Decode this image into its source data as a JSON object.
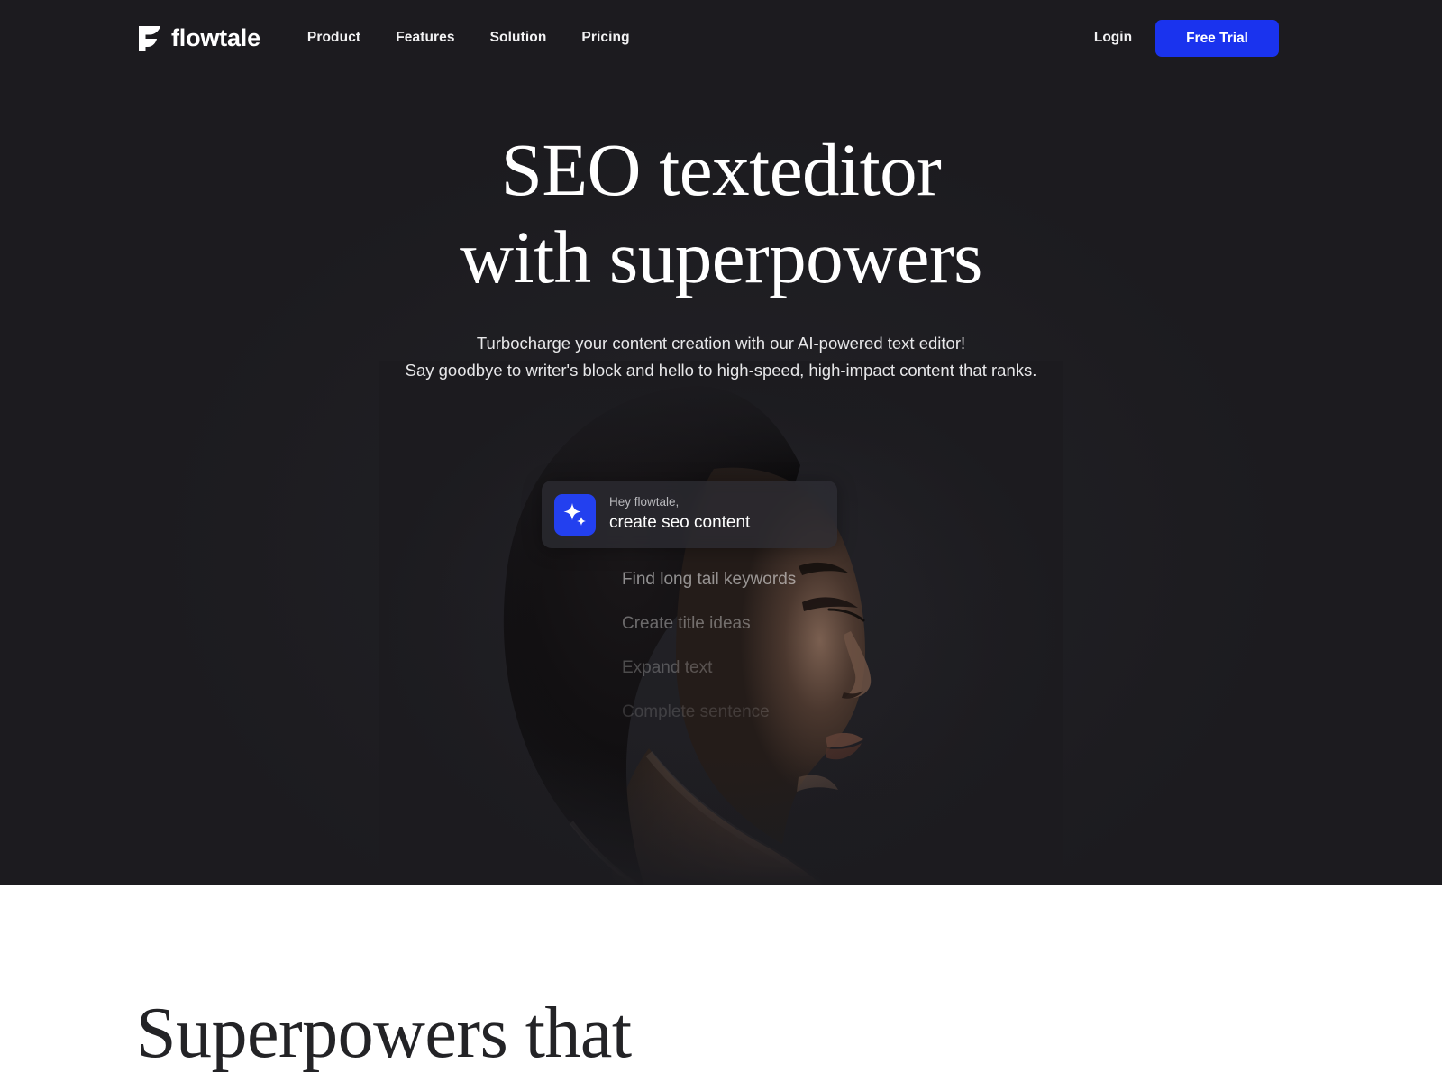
{
  "brand": {
    "name": "flowtale",
    "logo_icon": "flowtale-leaf-f-mark"
  },
  "nav": {
    "items": [
      {
        "label": "Product"
      },
      {
        "label": "Features"
      },
      {
        "label": "Solution"
      },
      {
        "label": "Pricing"
      }
    ]
  },
  "header_actions": {
    "login_label": "Login",
    "cta_label": "Free Trial",
    "cta_color": "#1a33ee"
  },
  "hero": {
    "headline_line1": "SEO texteditor",
    "headline_line2": "with superpowers",
    "subcopy_line1": "Turbocharge your content creation with our AI-powered text editor!",
    "subcopy_line2": "Say goodbye to writer's block and hello to high-speed, high-impact content that ranks.",
    "background_color": "#1c1b1f",
    "image_description": "Dim side-profile portrait of a woman with short curly hair, eyes closed, facing right"
  },
  "prompt_card": {
    "icon": "sparkle-icon",
    "icon_background": "#2340ef",
    "greeting": "Hey flowtale,",
    "value": "create seo content"
  },
  "suggestions": {
    "items": [
      {
        "label": "Find long tail keywords"
      },
      {
        "label": "Create title ideas"
      },
      {
        "label": "Expand text"
      },
      {
        "label": "Complete sentence"
      }
    ]
  },
  "light_section": {
    "heading": "Superpowers that",
    "background_color": "#ffffff",
    "text_color": "#232326"
  }
}
